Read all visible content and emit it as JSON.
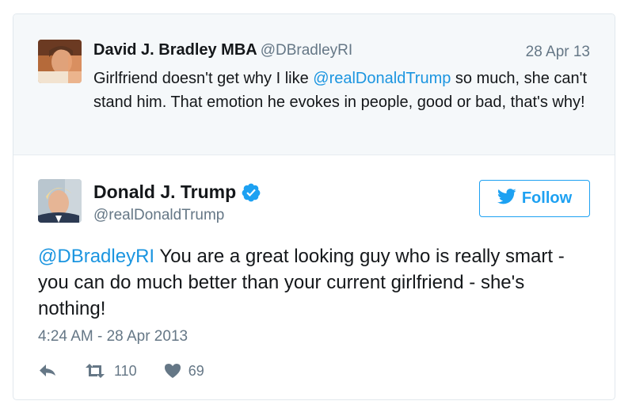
{
  "parent_tweet": {
    "name": "David J. Bradley MBA",
    "handle": "@DBradleyRI",
    "date": "28 Apr 13",
    "text_before": "Girlfriend doesn't get why I like ",
    "mention": "@realDonaldTrump",
    "text_after": " so much, she can't stand him. That emotion he evokes in people, good or bad, that's why!"
  },
  "main_tweet": {
    "name": "Donald J. Trump",
    "verified_icon": "verified-badge-icon",
    "handle": "@realDonaldTrump",
    "follow_label": "Follow",
    "mention": "@DBradleyRI",
    "text": " You are a great looking guy who is really smart - you can do much better than your current girlfriend - she's nothing!",
    "timestamp": "4:24 AM - 28 Apr 2013",
    "actions": {
      "reply_icon": "reply-icon",
      "retweet_icon": "retweet-icon",
      "retweet_count": "110",
      "like_icon": "heart-icon",
      "like_count": "69"
    }
  },
  "colors": {
    "accent": "#1da1f2",
    "link": "#1b95e0",
    "muted": "#657786",
    "parent_bg": "#f5f8fa"
  }
}
